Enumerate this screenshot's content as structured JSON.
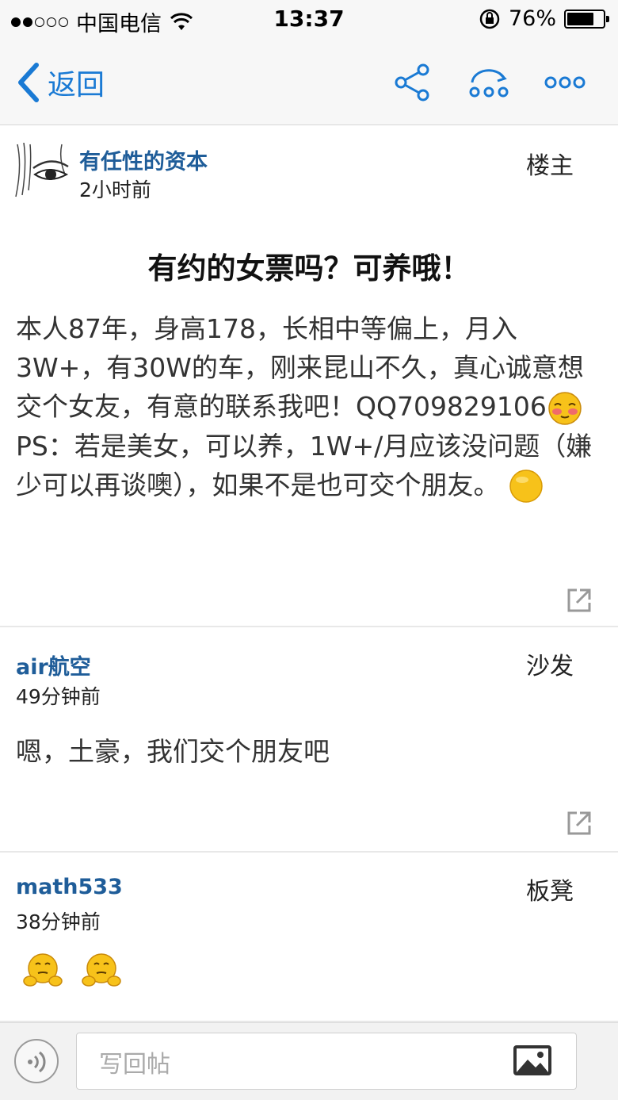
{
  "status_bar": {
    "carrier": "中国电信",
    "time": "13:37",
    "battery_percent": "76%",
    "battery_level": 0.76,
    "signal_strength": 2,
    "signal_total": 5
  },
  "nav": {
    "back_label": "返回",
    "icons": [
      "share-icon",
      "refresh-icon",
      "more-icon"
    ],
    "accent_color": "#1a7ad4"
  },
  "main_post": {
    "author": "有任性的资本",
    "time_ago": "2小时前",
    "floor_label": "楼主",
    "title": "有约的女票吗？可养哦！",
    "body_line1": "本人87年，身高178，长相中等偏上，月入3W+，有30W的车，刚来昆山不久，真心诚意想交个女友，有意的联系我吧！QQ709829106",
    "body_line2": "PS：若是美女，可以养，1W+/月应该没问题（嫌少可以再谈噢），如果不是也可交个朋友。"
  },
  "replies": [
    {
      "author": "air航空",
      "time_ago": "49分钟前",
      "floor_label": "沙发",
      "body": "嗯，土豪，我们交个朋友吧"
    },
    {
      "author": "math533",
      "time_ago": "38分钟前",
      "floor_label": "板凳",
      "emojis": [
        "thinking-face-emoji",
        "thinking-face-emoji"
      ]
    }
  ],
  "composer": {
    "placeholder": "写回帖"
  },
  "colors": {
    "author_link": "#1f5d99",
    "emoji_yellow": "#f7c21a"
  }
}
